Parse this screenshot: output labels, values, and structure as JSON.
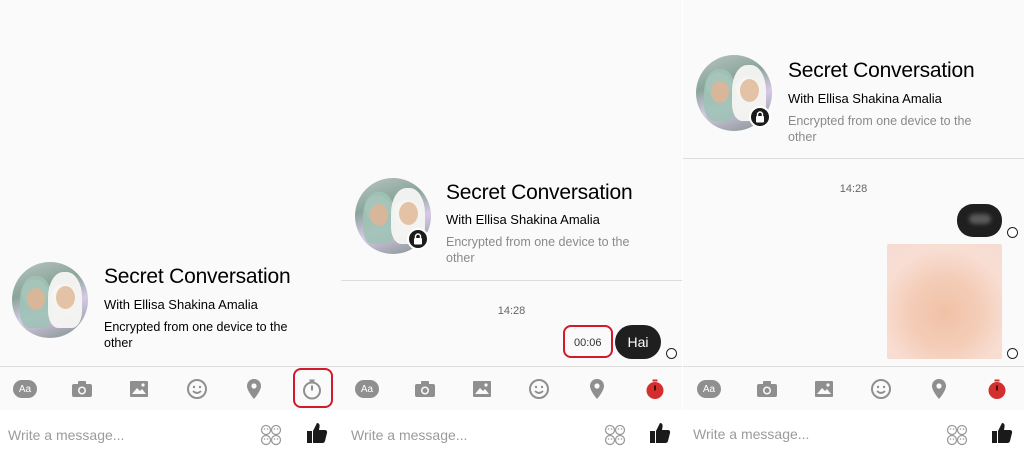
{
  "conversation": {
    "title": "Secret Conversation",
    "with": "With Ellisa Shakina Amalia",
    "encrypted": "Encrypted from one device to the other"
  },
  "timestamp": "14:28",
  "composer": {
    "placeholder": "Write a message..."
  },
  "toolbar": {
    "text_style_label": "Aa",
    "icons": [
      "text-style-icon",
      "camera-icon",
      "image-icon",
      "emoji-icon",
      "location-icon",
      "timer-icon"
    ]
  },
  "panel2": {
    "timer_value": "00:06",
    "message": "Hai"
  },
  "colors": {
    "bubble": "#1f1f1f",
    "highlight": "#d11a2a",
    "timer_active": "#d32f2f",
    "icon_gray": "#8f8f8f"
  }
}
